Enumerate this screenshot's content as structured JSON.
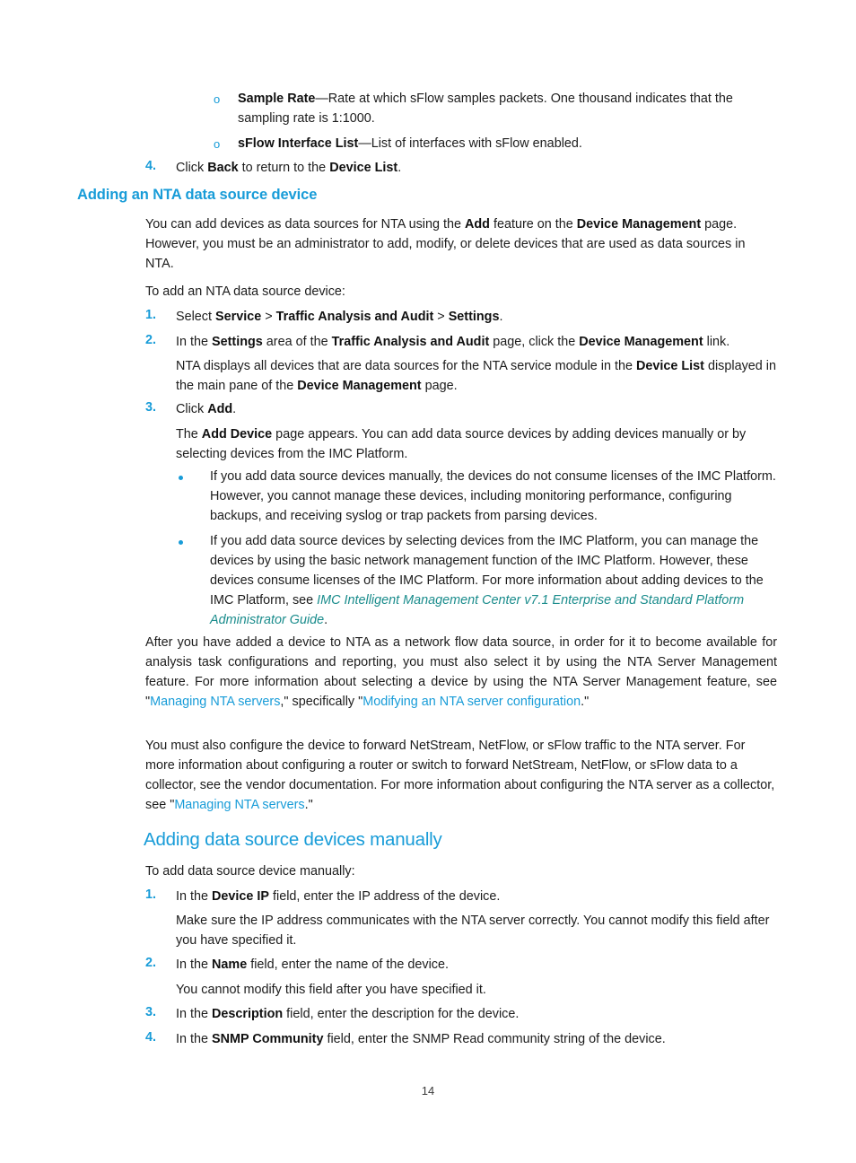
{
  "document": {
    "page_number": "14"
  },
  "sub_bullets_top": [
    {
      "marker": "o",
      "term": "Sample Rate",
      "text": "—Rate at which sFlow samples packets. One thousand indicates that the sampling rate is 1:1000."
    },
    {
      "marker": "o",
      "term": "sFlow Interface List",
      "text": "—List of interfaces with sFlow enabled."
    }
  ],
  "step_back": {
    "marker": "4.",
    "prefix": "Click ",
    "bold1": "Back",
    "middle": " to return to the ",
    "bold2": "Device List",
    "suffix": "."
  },
  "heading_nta_device": "Adding an NTA data source device",
  "intro_paragraph": {
    "part1": "You can add devices as data sources for NTA using the ",
    "bold1": "Add",
    "part2": " feature on the ",
    "bold2": "Device Management",
    "part3": " page. However, you must be an administrator to add, modify, or delete devices that are used as data sources in NTA."
  },
  "to_add_line": "To add an NTA data source device:",
  "steps": [
    {
      "marker": "1.",
      "segments": [
        {
          "t": "Select ",
          "style": "normal"
        },
        {
          "t": "Service",
          "style": "bold"
        },
        {
          "t": " > ",
          "style": "normal"
        },
        {
          "t": "Traffic Analysis and Audit",
          "style": "bold"
        },
        {
          "t": " > ",
          "style": "normal"
        },
        {
          "t": "Settings",
          "style": "bold"
        },
        {
          "t": ".",
          "style": "normal"
        }
      ]
    },
    {
      "marker": "2.",
      "segments": [
        {
          "t": "In the ",
          "style": "normal"
        },
        {
          "t": "Settings",
          "style": "bold"
        },
        {
          "t": " area of the ",
          "style": "normal"
        },
        {
          "t": "Traffic Analysis and Audit",
          "style": "bold"
        },
        {
          "t": " page, click the ",
          "style": "normal"
        },
        {
          "t": "Device Management",
          "style": "bold"
        },
        {
          "t": " link.",
          "style": "normal"
        }
      ]
    }
  ],
  "step2_followup": {
    "part1": "NTA displays all devices that are data sources for the NTA service module in the ",
    "bold1": "Device List",
    "part2": " displayed in the main pane of the ",
    "bold2": "Device Management",
    "part3": " page."
  },
  "step3": {
    "marker": "3.",
    "prefix": "Click ",
    "bold1": "Add",
    "suffix": "."
  },
  "step3_followup": {
    "part1": "The ",
    "bold1": "Add Device",
    "part2": " page appears. You can add data source devices by adding devices manually or by selecting devices from the IMC Platform."
  },
  "bullets": [
    {
      "text": "If you add data source devices manually, the devices do not consume licenses of the IMC Platform. However, you cannot manage these devices, including monitoring performance, configuring backups, and receiving syslog or trap packets from parsing devices."
    },
    {
      "part1": "If you add data source devices by selecting devices from the IMC Platform, you can manage the devices by using the basic network management function of the IMC Platform. However, these devices consume licenses of the IMC Platform. For more information about adding devices to the IMC Platform, see ",
      "link_italic": "IMC Intelligent Management Center v7.1 Enterprise and Standard Platform Administrator Guide",
      "part2": "."
    }
  ],
  "paragraph_after_bullets": {
    "part1": "After you have added a device to NTA as a network flow data source, in order for it to become available for analysis task configurations and reporting, you must also select it by using the NTA Server Management feature. For more information about selecting a device by using the NTA Server Management feature, see \"",
    "link1": "Managing NTA servers",
    "part2": ",\" specifically \"",
    "link2": "Modifying an NTA server configuration",
    "part3": ".\""
  },
  "paragraph_netstream": {
    "part1": "You must also configure the device to forward NetStream, NetFlow, or sFlow traffic to the NTA server. For more information about configuring a router or switch to forward NetStream, NetFlow, or sFlow data to a collector, see the vendor documentation. For more information about configuring the NTA server as a collector, see \"",
    "link1": "Managing NTA servers",
    "part2": ".\""
  },
  "heading_manual": "Adding data source devices manually",
  "to_add_manual_line": "To add data source device manually:",
  "manual_steps": [
    {
      "marker": "1.",
      "part1": "In the ",
      "bold1": "Device IP",
      "part2": " field, enter the IP address of the device."
    },
    {
      "marker": "2.",
      "part1": "In the ",
      "bold1": "Name",
      "part2": " field, enter the name of the device."
    },
    {
      "marker": "3.",
      "part1": "In the ",
      "bold1": "Description",
      "part2": " field, enter the description for the device."
    },
    {
      "marker": "4.",
      "part1": "In the ",
      "bold1": "SNMP Community",
      "part2": " field, enter the SNMP Read community string of the device."
    }
  ],
  "manual_note_1": "Make sure the IP address communicates with the NTA server correctly. You cannot modify this field after you have specified it.",
  "manual_note_2": "You cannot modify this field after you have specified it.",
  "colors": {
    "heading_blue": "#189CD8",
    "link_blue": "#189CD8",
    "link_italic_teal": "#1A8C8C",
    "body_black": "#1c1c1c"
  }
}
